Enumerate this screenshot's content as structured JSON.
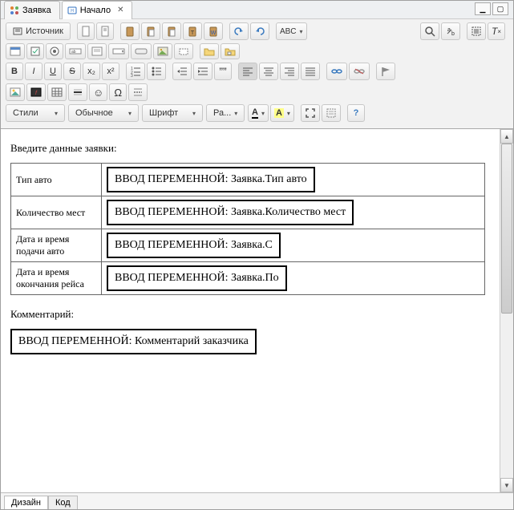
{
  "tabs": {
    "t1": "Заявка",
    "t2": "Начало"
  },
  "toolbar": {
    "source": "Источник",
    "styles": "Стили",
    "format": "Обычное",
    "font": "Шрифт",
    "size": "Ра...",
    "textcolor": "A",
    "bgcolor": "A",
    "bold": "B",
    "italic": "I",
    "underline": "U",
    "strike": "S",
    "sub": "x₂",
    "sup": "x²",
    "quote": "””",
    "omega": "Ω",
    "smile": "☺",
    "question": "?"
  },
  "content": {
    "prompt": "Введите данные заявки:",
    "rows": [
      {
        "label": "Тип авто",
        "value": "ВВОД ПЕРЕМЕННОЙ: Заявка.Тип авто"
      },
      {
        "label": "Количество мест",
        "value": "ВВОД ПЕРЕМЕННОЙ: Заявка.Количество мест"
      },
      {
        "label": "Дата и время подачи авто",
        "value": "ВВОД ПЕРЕМЕННОЙ: Заявка.С"
      },
      {
        "label": "Дата и время окончания рейса",
        "value": "ВВОД ПЕРЕМЕННОЙ: Заявка.По"
      }
    ],
    "comment_label": "Комментарий:",
    "comment_value": "ВВОД ПЕРЕМЕННОЙ: Комментарий заказчика"
  },
  "footer": {
    "design": "Дизайн",
    "code": "Код"
  }
}
